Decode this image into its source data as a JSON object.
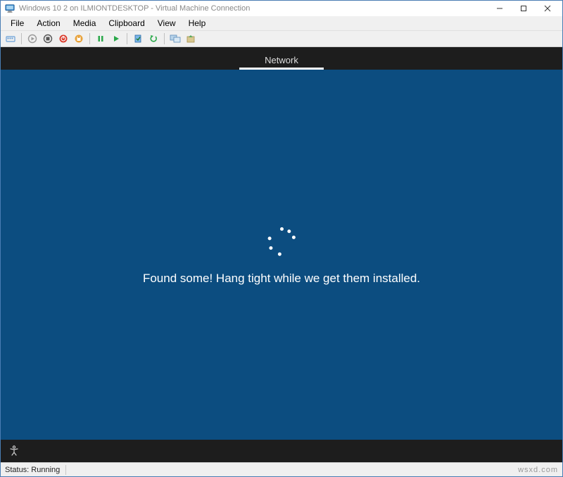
{
  "window": {
    "title": "Windows 10 2 on ILMIONTDESKTOP - Virtual Machine Connection"
  },
  "menu": {
    "file": "File",
    "action": "Action",
    "media": "Media",
    "clipboard": "Clipboard",
    "view": "View",
    "help": "Help"
  },
  "guest": {
    "tab_label": "Network",
    "message": "Found some! Hang tight while we get them installed."
  },
  "status": {
    "label": "Status: Running",
    "watermark": "wsxd.com"
  },
  "colors": {
    "oobe_bg": "#0c4d80",
    "dark_bar": "#1d1d1d"
  }
}
